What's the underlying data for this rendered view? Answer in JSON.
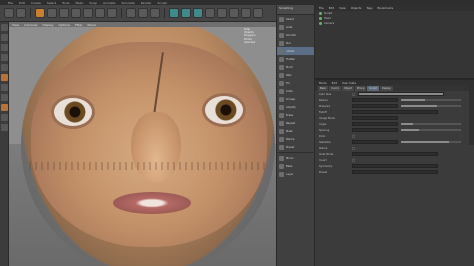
{
  "menubar": {
    "items": [
      "File",
      "Edit",
      "Create",
      "Select",
      "Tools",
      "Mesh",
      "Snap",
      "Animate",
      "Simulate",
      "Render",
      "Sculpt",
      "Motion Tracker",
      "MoGraph",
      "Character",
      "Pipeline",
      "Plugins",
      "Script",
      "Window",
      "Help"
    ]
  },
  "viewport": {
    "menu": [
      "View",
      "Cameras",
      "Display",
      "Options",
      "Filter",
      "Panel"
    ],
    "hud_lines": [
      "Total",
      "Objects",
      "Polygons",
      "Points",
      "Selected"
    ]
  },
  "attr_strip": {
    "header": "Sculpting",
    "items": [
      "Select",
      "Grab",
      "Smooth",
      "Pull",
      "Inflate",
      "Flatten",
      "Pinch",
      "Wax",
      "Fill",
      "Knife",
      "Scrape",
      "Amplify",
      "Erase",
      "Repeat",
      "Mask",
      "Stamp",
      "Preset"
    ],
    "active_index": 4,
    "lower_items": [
      "Mirror",
      "Bake",
      "Layer"
    ]
  },
  "right_panel": {
    "menu": [
      "File",
      "Edit",
      "View",
      "Objects",
      "Tags",
      "Bookmarks"
    ],
    "objects": [
      {
        "name": "Sculpt"
      },
      {
        "name": "Head"
      },
      {
        "name": "Camera"
      }
    ],
    "attr_menu": [
      "Mode",
      "Edit",
      "User Data"
    ],
    "tabs": [
      "Basic",
      "Coord.",
      "Object",
      "Phong",
      "Sculpt",
      "Display"
    ],
    "active_tab": 4,
    "properties": [
      {
        "label": "Auto Size"
      },
      {
        "label": "Radius"
      },
      {
        "label": "Pressure"
      },
      {
        "label": "Falloff"
      },
      {
        "label": "Image Mode"
      },
      {
        "label": "Angle"
      },
      {
        "label": "Spacing"
      },
      {
        "label": "Dots"
      },
      {
        "label": "Stabilizer"
      },
      {
        "label": "Stamp"
      },
      {
        "label": "Grab Mode"
      },
      {
        "label": "Invert"
      },
      {
        "label": "Symmetry"
      },
      {
        "label": "Preset"
      }
    ]
  },
  "colors": {
    "accent": "#c8802e",
    "teal": "#3f8a8a",
    "panel": "#3b3b3b",
    "active_blue": "#5a6f86"
  }
}
